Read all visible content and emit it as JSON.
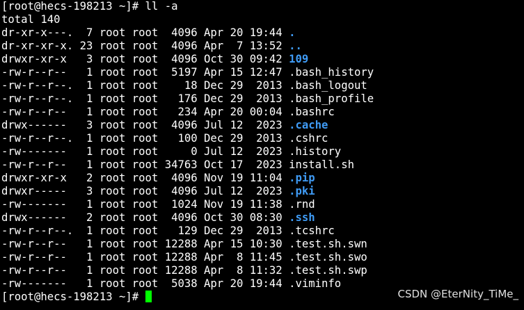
{
  "terminal": {
    "command_prompt": "[root@hecs-198213 ~]# ",
    "command": "ll -a",
    "total": "total 140",
    "entries": [
      {
        "meta": "dr-xr-x---.  7 root root  4096 Apr 20 19:44 ",
        "name": ".",
        "is_dir": true
      },
      {
        "meta": "dr-xr-xr-x. 23 root root  4096 Apr  7 13:52 ",
        "name": "..",
        "is_dir": true
      },
      {
        "meta": "drwxr-xr-x   3 root root  4096 Oct 30 09:42 ",
        "name": "109",
        "is_dir": true
      },
      {
        "meta": "-rw-r--r--   1 root root  5197 Apr 15 12:47 ",
        "name": ".bash_history",
        "is_dir": false
      },
      {
        "meta": "-rw-r--r--.  1 root root    18 Dec 29  2013 ",
        "name": ".bash_logout",
        "is_dir": false
      },
      {
        "meta": "-rw-r--r--.  1 root root   176 Dec 29  2013 ",
        "name": ".bash_profile",
        "is_dir": false
      },
      {
        "meta": "-rw-r--r--   1 root root   234 Apr 20 00:04 ",
        "name": ".bashrc",
        "is_dir": false
      },
      {
        "meta": "drwx------   3 root root  4096 Jul 12  2023 ",
        "name": ".cache",
        "is_dir": true
      },
      {
        "meta": "-rw-r--r--.  1 root root   100 Dec 29  2013 ",
        "name": ".cshrc",
        "is_dir": false
      },
      {
        "meta": "-rw-------   1 root root     0 Jul 12  2023 ",
        "name": ".history",
        "is_dir": false
      },
      {
        "meta": "-rw-r--r--   1 root root 34763 Oct 17  2023 ",
        "name": "install.sh",
        "is_dir": false
      },
      {
        "meta": "drwxr-xr-x   2 root root  4096 Nov 19 11:04 ",
        "name": ".pip",
        "is_dir": true
      },
      {
        "meta": "drwxr-----   3 root root  4096 Jul 12  2023 ",
        "name": ".pki",
        "is_dir": true
      },
      {
        "meta": "-rw-------   1 root root  1024 Nov 19 11:38 ",
        "name": ".rnd",
        "is_dir": false
      },
      {
        "meta": "drwx------   2 root root  4096 Oct 30 08:30 ",
        "name": ".ssh",
        "is_dir": true
      },
      {
        "meta": "-rw-r--r--.  1 root root   129 Dec 29  2013 ",
        "name": ".tcshrc",
        "is_dir": false
      },
      {
        "meta": "-rw-r--r--   1 root root 12288 Apr 15 10:30 ",
        "name": ".test.sh.swn",
        "is_dir": false
      },
      {
        "meta": "-rw-r--r--   1 root root 12288 Apr  8 11:45 ",
        "name": ".test.sh.swo",
        "is_dir": false
      },
      {
        "meta": "-rw-r--r--   1 root root 12288 Apr  8 11:32 ",
        "name": ".test.sh.swp",
        "is_dir": false
      },
      {
        "meta": "-rw-------   1 root root  5038 Apr 20 19:44 ",
        "name": ".viminfo",
        "is_dir": false
      }
    ],
    "final_prompt": "[root@hecs-198213 ~]# "
  },
  "watermark": "CSDN @EterNity_TiMe_",
  "colors": {
    "background": "#000000",
    "text": "#ffffff",
    "directory": "#3f9bf5",
    "cursor": "#00ff00"
  }
}
